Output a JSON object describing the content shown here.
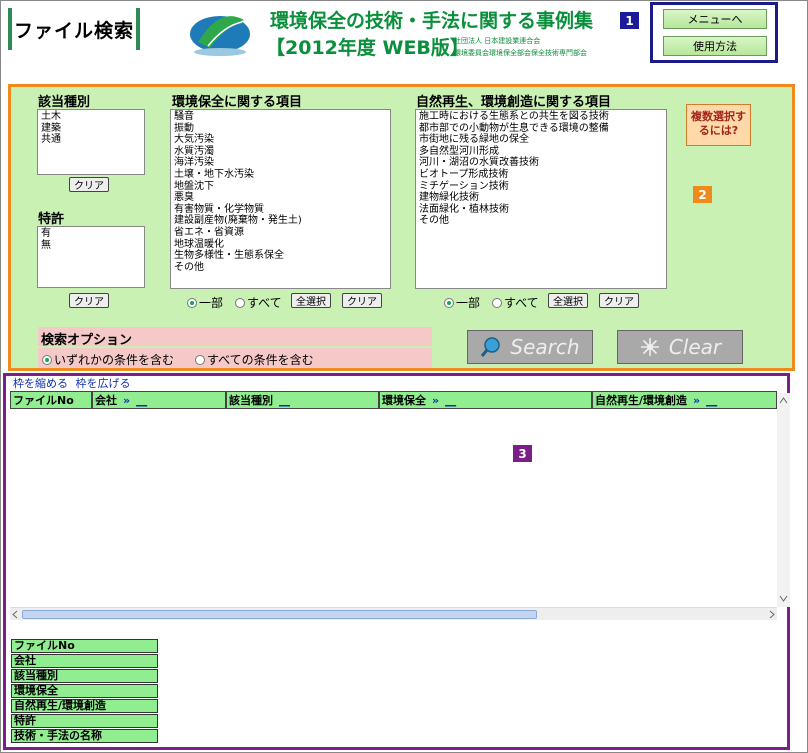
{
  "header": {
    "page_title": "ファイル検索",
    "app_title": "環境保全の技術・手法に関する事例集",
    "app_subtitle": "【2012年度 WEB版】",
    "org_line1": "社団法人 日本建設業連合会",
    "org_line2": "環境委員会環境保全部会保全技術専門部会",
    "badge1": "1",
    "menu_button": "メニューへ",
    "usage_button": "使用方法"
  },
  "search": {
    "badge2": "2",
    "category": {
      "label": "該当種別",
      "items": [
        "土木",
        "建築",
        "共通"
      ],
      "clear": "クリア"
    },
    "patent": {
      "label": "特許",
      "items": [
        "有",
        "無"
      ],
      "clear": "クリア"
    },
    "env": {
      "label": "環境保全に関する項目",
      "items": [
        "騒音",
        "振動",
        "大気汚染",
        "水質汚濁",
        "海洋汚染",
        "土壌・地下水汚染",
        "地盤沈下",
        "悪臭",
        "有害物質・化学物質",
        "建設副産物(廃棄物・発生土)",
        "省エネ・省資源",
        "地球温暖化",
        "生物多様性・生態系保全",
        "その他"
      ],
      "radio_partial": "一部",
      "radio_all": "すべて",
      "select_all": "全選択",
      "clear": "クリア"
    },
    "nature": {
      "label": "自然再生、環境創造に関する項目",
      "items": [
        "施工時における生態系との共生を図る技術",
        "都市部での小動物が生息できる環境の整備",
        "市街地に残る緑地の保全",
        "多自然型河川形成",
        "河川・湖沼の水質改善技術",
        "ビオトープ形成技術",
        "ミチゲーション技術",
        "建物緑化技術",
        "法面緑化・植林技術",
        "その他"
      ],
      "radio_partial": "一部",
      "radio_all": "すべて",
      "select_all": "全選択",
      "clear": "クリア"
    },
    "help_label": "複数選択するには?",
    "options": {
      "label": "検索オプション",
      "any": "いずれかの条件を含む",
      "all": "すべての条件を含む"
    },
    "search_button": "Search",
    "clear_button": "Clear"
  },
  "results": {
    "badge3": "3",
    "shrink_link": "枠を縮める",
    "expand_link": "枠を広げる",
    "columns": [
      {
        "label": "ファイルNo",
        "arrow": "",
        "ul": ""
      },
      {
        "label": "会社",
        "arrow": "»",
        "ul": "__"
      },
      {
        "label": "該当種別",
        "arrow": "",
        "ul": "__"
      },
      {
        "label": "環境保全",
        "arrow": "»",
        "ul": "__"
      },
      {
        "label": "自然再生/環境創造",
        "arrow": "»",
        "ul": "__"
      }
    ],
    "field_list": [
      "ファイルNo",
      "会社",
      "該当種別",
      "環境保全",
      "自然再生/環境創造",
      "特許",
      "技術・手法の名称"
    ]
  },
  "colors": {
    "panel_bg": "#c9f1b4",
    "panel_border": "#f08a1c",
    "header_cell": "#90ee90",
    "results_border": "#7a1f8a",
    "menu_border": "#1a1a8a",
    "title_green": "#0a8f3c"
  }
}
